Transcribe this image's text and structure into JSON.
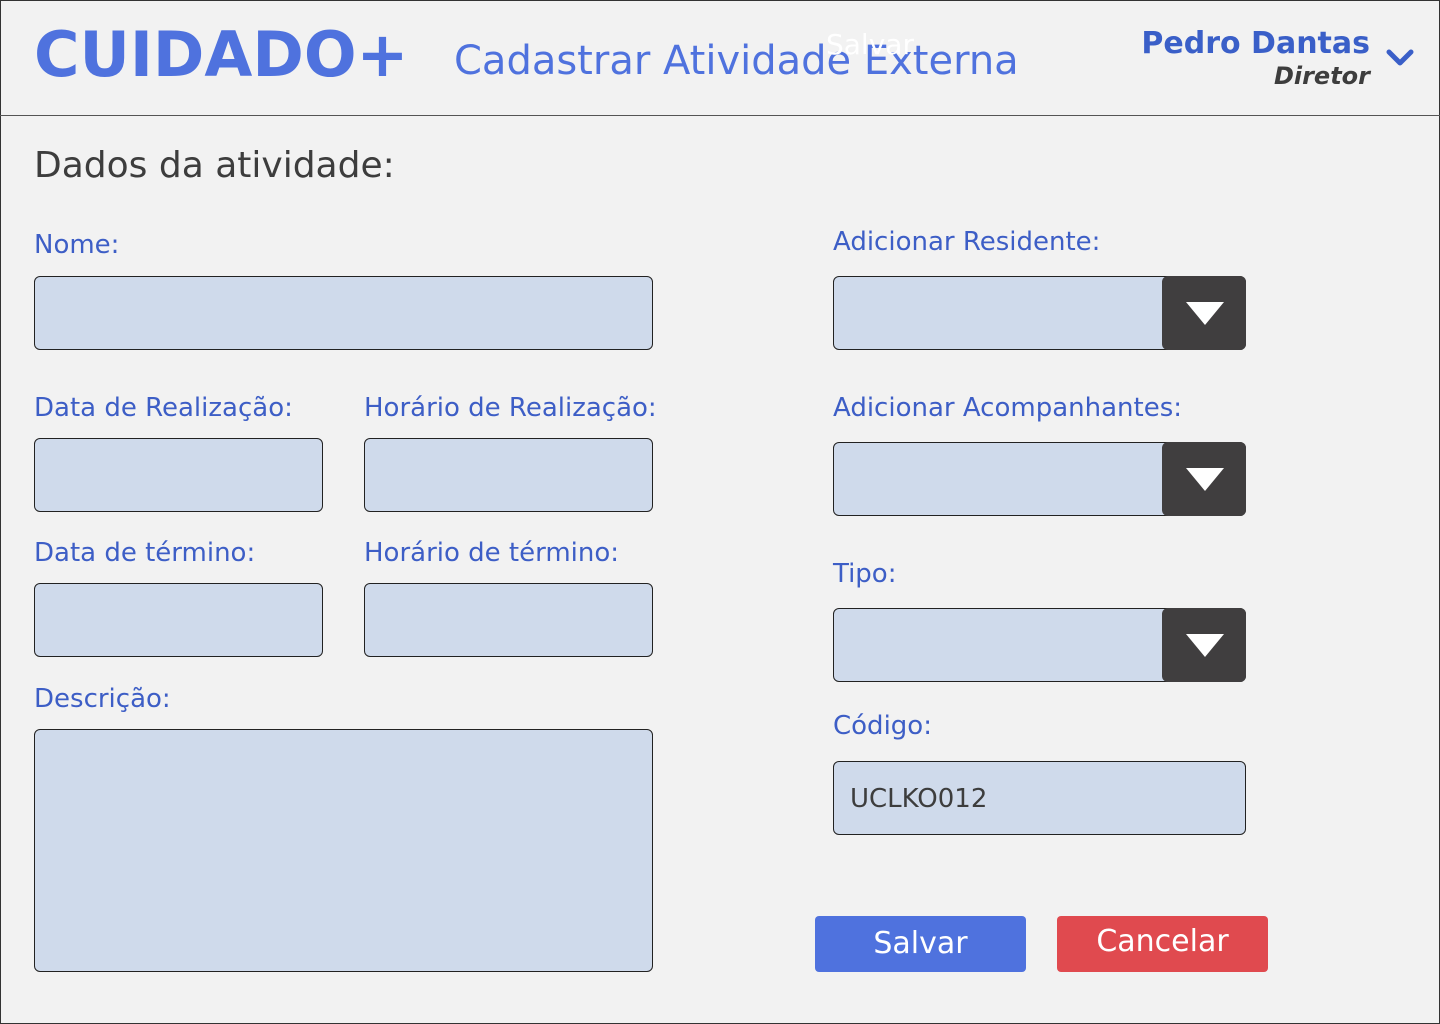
{
  "header": {
    "logo": "CUIDADO+",
    "title": "Cadastrar Atividade Externa",
    "overlay_text": "Salvar",
    "user": {
      "name": "Pedro Dantas",
      "role": "Diretor"
    }
  },
  "form": {
    "section_title": "Dados da atividade:",
    "nome": {
      "label": "Nome:",
      "value": ""
    },
    "data_realizacao": {
      "label": "Data de Realização:",
      "value": ""
    },
    "horario_realizacao": {
      "label": "Horário de Realização:",
      "value": ""
    },
    "data_termino": {
      "label": "Data de término:",
      "value": ""
    },
    "horario_termino": {
      "label": "Horário de término:",
      "value": ""
    },
    "descricao": {
      "label": "Descrição:",
      "value": ""
    },
    "residente": {
      "label": "Adicionar Residente:",
      "value": ""
    },
    "acompanhantes": {
      "label": "Adicionar Acompanhantes:",
      "value": ""
    },
    "tipo": {
      "label": "Tipo:",
      "value": ""
    },
    "codigo": {
      "label": "Código:",
      "value": "UCLKO012"
    }
  },
  "actions": {
    "save_label": "Salvar",
    "cancel_label": "Cancelar"
  },
  "colors": {
    "accent": "#4f72de",
    "danger": "#e04a4f",
    "field_bg": "#cfdaeb",
    "select_button": "#403e3f",
    "page_bg": "#f2f2f2"
  },
  "icons": {
    "user_menu": "chevron-down-icon",
    "select": "triangle-down-icon"
  }
}
